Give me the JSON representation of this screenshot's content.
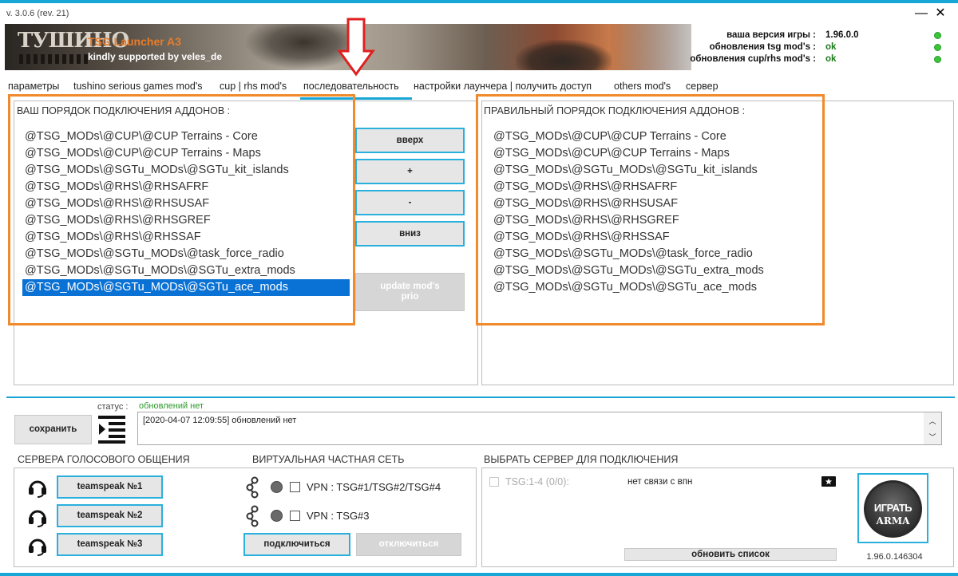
{
  "window": {
    "version": "v. 3.0.6 (rev. 21)",
    "minimize_label": "—",
    "close_label": "✕"
  },
  "banner": {
    "logo_text": "ТУШИНО",
    "title": "TSG Launcher A3",
    "subtitle": "kindly supported by veles_de"
  },
  "info": {
    "game_version_label": "ваша версия игры :",
    "game_version_value": "1.96.0.0",
    "tsg_updates_label": "обновления tsg mod's :",
    "tsg_updates_value": "ok",
    "cup_updates_label": "обновления cup/rhs mod's :",
    "cup_updates_value": "ok",
    "status_color": "#3cc43c"
  },
  "tabs": [
    {
      "label": "параметры"
    },
    {
      "label": "tushino serious games mod's"
    },
    {
      "label": "cup | rhs mod's"
    },
    {
      "label": "последовательность"
    },
    {
      "label": "настройки лаунчера | получить доступ"
    },
    {
      "label": "others mod's"
    },
    {
      "label": "сервер"
    }
  ],
  "active_tab": "последовательность",
  "left_panel": {
    "title": "ВАШ ПОРЯДОК ПОДКЛЮЧЕНИЯ АДДОНОВ :",
    "items": [
      "@TSG_MODs\\@CUP\\@CUP Terrains - Core",
      "@TSG_MODs\\@CUP\\@CUP Terrains - Maps",
      "@TSG_MODs\\@SGTu_MODs\\@SGTu_kit_islands",
      "@TSG_MODs\\@RHS\\@RHSAFRF",
      "@TSG_MODs\\@RHS\\@RHSUSAF",
      "@TSG_MODs\\@RHS\\@RHSGREF",
      "@TSG_MODs\\@RHS\\@RHSSAF",
      "@TSG_MODs\\@SGTu_MODs\\@task_force_radio",
      "@TSG_MODs\\@SGTu_MODs\\@SGTu_extra_mods",
      "@TSG_MODs\\@SGTu_MODs\\@SGTu_ace_mods"
    ],
    "selected_index": 9
  },
  "order_buttons": {
    "up": "вверх",
    "plus": "+",
    "minus": "-",
    "down": "вниз",
    "update_line1": "update mod's",
    "update_line2": "prio"
  },
  "right_panel": {
    "title": "ПРАВИЛЬНЫЙ ПОРЯДОК ПОДКЛЮЧЕНИЯ АДДОНОВ :",
    "items": [
      "@TSG_MODs\\@CUP\\@CUP Terrains - Core",
      "@TSG_MODs\\@CUP\\@CUP Terrains - Maps",
      "@TSG_MODs\\@SGTu_MODs\\@SGTu_kit_islands",
      "@TSG_MODs\\@RHS\\@RHSAFRF",
      "@TSG_MODs\\@RHS\\@RHSUSAF",
      "@TSG_MODs\\@RHS\\@RHSGREF",
      "@TSG_MODs\\@RHS\\@RHSSAF",
      "@TSG_MODs\\@SGTu_MODs\\@task_force_radio",
      "@TSG_MODs\\@SGTu_MODs\\@SGTu_extra_mods",
      "@TSG_MODs\\@SGTu_MODs\\@SGTu_ace_mods"
    ]
  },
  "status": {
    "save_label": "сохранить",
    "label": "статус :",
    "value": "обновлений нет",
    "log": "[2020-04-07 12:09:55] обновлений нет"
  },
  "voice": {
    "title": "СЕРВЕРА ГОЛОСОВОГО ОБЩЕНИЯ",
    "ts1": "teamspeak №1",
    "ts2": "teamspeak №2",
    "ts3": "teamspeak №3"
  },
  "vpn": {
    "title": "ВИРТУАЛЬНАЯ ЧАСТНАЯ СЕТЬ",
    "vpn1": "VPN : TSG#1/TSG#2/TSG#4",
    "vpn2": "VPN : TSG#3",
    "connect": "подключиться",
    "disconnect": "отключиться"
  },
  "server": {
    "title": "ВЫБРАТЬ СЕРВЕР ДЛЯ ПОДКЛЮЧЕНИЯ",
    "row_label": "TSG:1-4 (0/0):",
    "row_status": "нет связи с впн",
    "refresh": "обновить список",
    "play_line1": "ИГРАТЬ",
    "play_line2": "ARMA",
    "build": "1.96.0.146304"
  }
}
